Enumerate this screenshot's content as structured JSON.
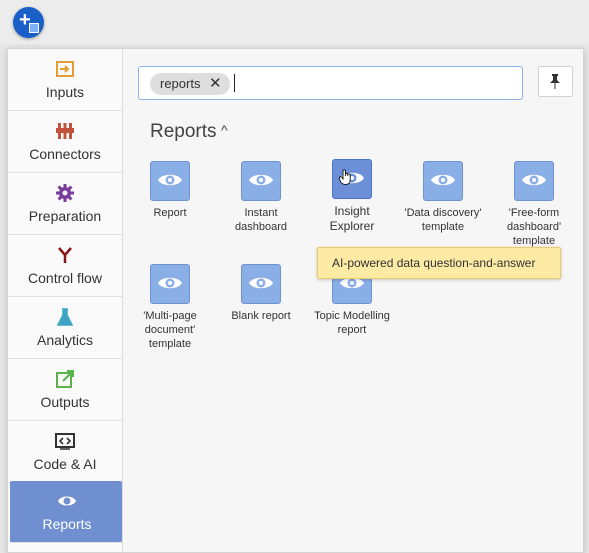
{
  "sidebar": {
    "items": [
      {
        "label": "Inputs",
        "icon": "inputs-icon",
        "color": "#e59c35"
      },
      {
        "label": "Connectors",
        "icon": "connectors-icon",
        "color": "#c0533a"
      },
      {
        "label": "Preparation",
        "icon": "gear-icon",
        "color": "#7a3a9c"
      },
      {
        "label": "Control flow",
        "icon": "branch-icon",
        "color": "#8a1616"
      },
      {
        "label": "Analytics",
        "icon": "flask-icon",
        "color": "#3ea4c6"
      },
      {
        "label": "Outputs",
        "icon": "export-icon",
        "color": "#59b149"
      },
      {
        "label": "Code & AI",
        "icon": "code-icon",
        "color": "#333333"
      },
      {
        "label": "Reports",
        "icon": "eye-icon",
        "color": "#ffffff"
      }
    ]
  },
  "search": {
    "chip": "reports",
    "chip_remove": "✕",
    "value": ""
  },
  "section": {
    "title": "Reports",
    "chevron": "^"
  },
  "tiles": [
    {
      "label": "Report"
    },
    {
      "label": "Instant dashboard"
    },
    {
      "label": "Insight Explorer"
    },
    {
      "label": "'Data discovery' template"
    },
    {
      "label": "'Free-form dashboard' template"
    },
    {
      "label": "'Multi-page document' template"
    },
    {
      "label": "Blank report"
    },
    {
      "label": "Topic Modelling report"
    }
  ],
  "tooltip": {
    "text": "AI-powered data question-and-answer"
  },
  "colors": {
    "accent": "#1a5fc8",
    "tile": "#8aaee6",
    "active": "#6f8fd1",
    "tooltip": "#fdeaa5"
  }
}
